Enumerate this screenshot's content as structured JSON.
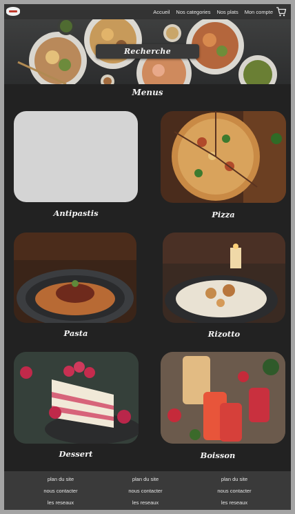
{
  "nav": {
    "logo_icon": "restaurant-logo",
    "links": [
      "Accueil",
      "Nos categories",
      "Nos plats",
      "Mon compte"
    ],
    "cart_icon": "cart-icon"
  },
  "hero": {
    "search_label": "Recherche"
  },
  "menus": {
    "title": "Menus",
    "items": [
      {
        "label": "Antipastis"
      },
      {
        "label": "Pizza"
      },
      {
        "label": "Pasta"
      },
      {
        "label": "Rizotto"
      },
      {
        "label": "Dessert"
      },
      {
        "label": "Boisson"
      }
    ]
  },
  "footer": {
    "columns": [
      [
        "plan du site",
        "nous contacter",
        "les reseaux"
      ],
      [
        "plan du site",
        "nous contacter",
        "les reseaux"
      ],
      [
        "plan du site",
        "nous contacter",
        "les reseaux"
      ]
    ]
  },
  "colors": {
    "background": "#222222",
    "nav": "#333333",
    "footer": "#3a3a3a",
    "outer": "#a4a4a4"
  }
}
